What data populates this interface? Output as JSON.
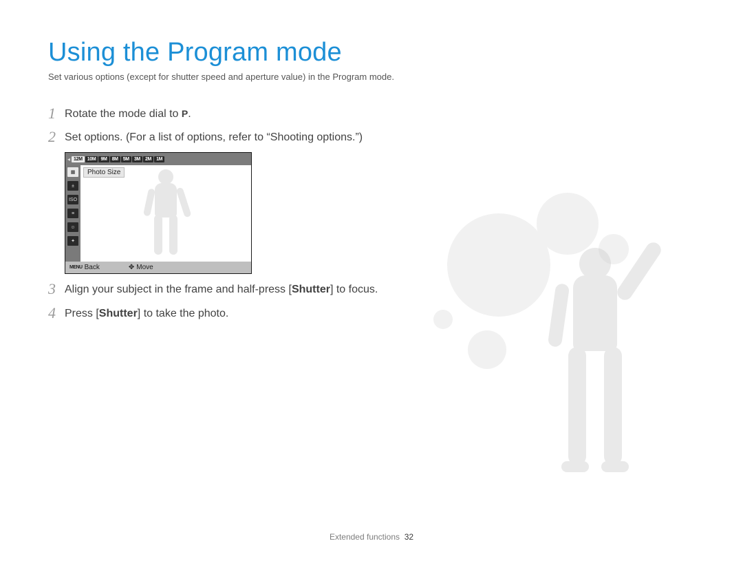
{
  "title": "Using the Program mode",
  "subtitle": "Set various options (except for shutter speed and aperture value) in the Program mode.",
  "steps": {
    "s1_pre": "Rotate the mode dial to ",
    "s1_icon": "P",
    "s1_post": ".",
    "s2": "Set options. (For a list of options, refer to “Shooting options.”)",
    "s3_pre": "Align your subject in the frame and half-press [",
    "s3_bold": "Shutter",
    "s3_post": "] to focus.",
    "s4_pre": "Press [",
    "s4_bold": "Shutter",
    "s4_post": "] to take the photo."
  },
  "camera": {
    "size_options": [
      "12M",
      "10M",
      "9M",
      "8M",
      "5M",
      "3M",
      "2M",
      "1M"
    ],
    "side_icons": [
      "size",
      "ev",
      "iso",
      "wb",
      "face",
      "af"
    ],
    "label": "Photo Size",
    "footer_menu_icon": "MENU",
    "footer_back": "Back",
    "footer_move": "Move"
  },
  "footer": {
    "section": "Extended functions",
    "page": "32"
  }
}
